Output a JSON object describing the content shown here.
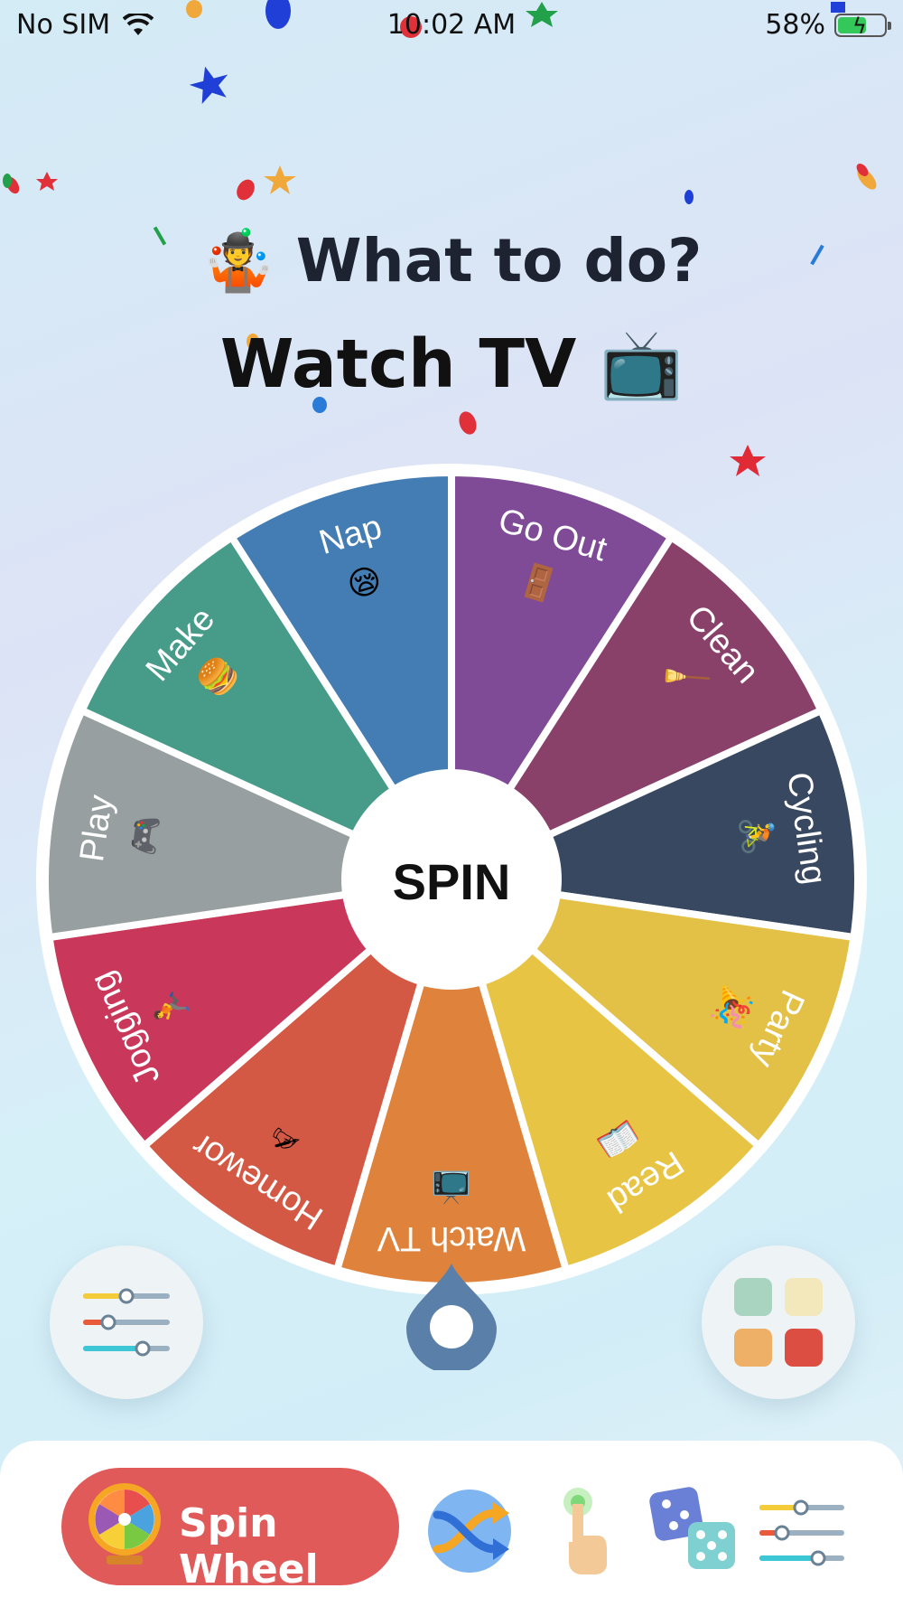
{
  "status_bar": {
    "carrier": "No SIM",
    "time": "10:02 AM",
    "battery": "58%"
  },
  "title": {
    "emoji": "🤹",
    "text": "What to do?"
  },
  "result": {
    "text": "Watch TV",
    "emoji": "📺"
  },
  "wheel": {
    "center_label": "SPIN",
    "segments": [
      {
        "label": "Go Out",
        "emoji": "🚪",
        "color": "#7f4a96"
      },
      {
        "label": "Clean",
        "emoji": "🧹",
        "color": "#89416a"
      },
      {
        "label": "Cycling",
        "emoji": "🚴",
        "color": "#374860"
      },
      {
        "label": "Party",
        "emoji": "🎉",
        "color": "#e3c046"
      },
      {
        "label": "Read",
        "emoji": "📖",
        "color": "#e8c444"
      },
      {
        "label": "Watch TV",
        "emoji": "📺",
        "color": "#df823b"
      },
      {
        "label": "Homewor",
        "emoji": "✍",
        "color": "#d35944"
      },
      {
        "label": "Jogging",
        "emoji": "🏃",
        "color": "#c9385a"
      },
      {
        "label": "Play",
        "emoji": "🎮",
        "color": "#979fa0"
      },
      {
        "label": "Make",
        "emoji": "🍔",
        "color": "#469c88"
      },
      {
        "label": "Nap",
        "emoji": "😪",
        "color": "#437db4"
      }
    ]
  },
  "colors": {
    "pointer": "#5a7fa8",
    "spin_tab": "#e05a5a"
  },
  "buttons": {
    "left": "settings-sliders-icon",
    "right": "palette-grid-icon"
  },
  "tab_bar": {
    "active_label": "Spin Wheel",
    "items": [
      "spin-wheel-icon",
      "random-shuffle-icon",
      "finger-tap-icon",
      "dice-icon",
      "sliders-icon"
    ]
  }
}
